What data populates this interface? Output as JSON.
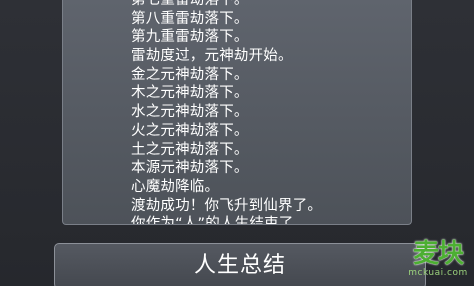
{
  "log": {
    "lines": [
      "第七重雷劫落下。",
      "第八重雷劫落下。",
      "第九重雷劫落下。",
      "雷劫度过，元神劫开始。",
      "金之元神劫落下。",
      "木之元神劫落下。",
      "水之元神劫落下。",
      "火之元神劫落下。",
      "土之元神劫落下。",
      "本源元神劫落下。",
      "心魔劫降临。",
      "渡劫成功！你飞升到仙界了。",
      "你作为“人”的人生结束了。"
    ]
  },
  "summary_button": {
    "label": "人生总结"
  },
  "watermark": {
    "logo_text": "麦块",
    "url_text": "mckuai.com",
    "color": "#4caf32"
  }
}
